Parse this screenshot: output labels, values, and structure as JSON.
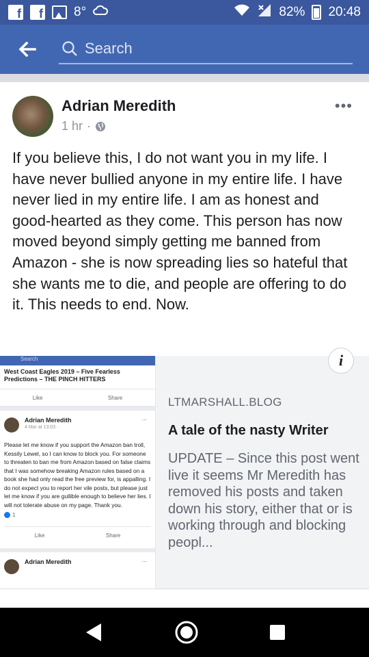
{
  "status": {
    "time": "20:48",
    "battery": "82%",
    "temp": "8°"
  },
  "search": {
    "placeholder": "Search"
  },
  "post": {
    "author": "Adrian Meredith",
    "time": "1 hr",
    "separator": "·",
    "text": "If you believe this, I do not want you in my life. I have never bullied anyone in my entire life. I have never lied in my entire life. I am as honest and good-hearted as they come. This person has now moved beyond simply getting me banned from Amazon - she is now spreading lies so hateful that she wants me to die, and people are offering to do it. This needs to end. Now."
  },
  "link": {
    "domain": "LTMARSHALL.BLOG",
    "title": "A tale of the nasty Writer",
    "description": "UPDATE – Since this post went live it seems Mr Meredith has removed his posts and taken down his story, either that or is working through and blocking peopl...",
    "info_label": "i"
  },
  "preview": {
    "search_stub": "Search",
    "shared_title": "West Coast Eagles 2019 – Five Fearless Predictions – THE PINCH HITTERS",
    "like": "Like",
    "share": "Share",
    "dots": "...",
    "post_author": "Adrian Meredith",
    "post_time": "4 Mar at 13:03 ·",
    "post_text": "Please let me know if you support the Amazon ban troll, Kessily Lewel, so I can know to block you. For someone to threaten to ban me from Amazon based on false claims that I was somehow breaking Amazon rules based on a book she had only read the free preview for, is appalling. I do not expect you to report her vile posts, but please just let me know if you are gullible enough to believe her lies. I will not tolerate abuse on my page. Thank you.",
    "reaction_count": "1",
    "next_author": "Adrian Meredith"
  },
  "colors": {
    "facebook_blue": "#4267b2",
    "statusbar_blue": "#3b579d"
  },
  "icons": [
    "facebook-icon",
    "image-icon",
    "cloud-icon",
    "wifi-icon",
    "signal-icon",
    "battery-icon",
    "back-arrow-icon",
    "search-icon",
    "globe-icon",
    "more-icon",
    "info-icon",
    "nav-back-icon",
    "nav-home-icon",
    "nav-recents-icon"
  ]
}
